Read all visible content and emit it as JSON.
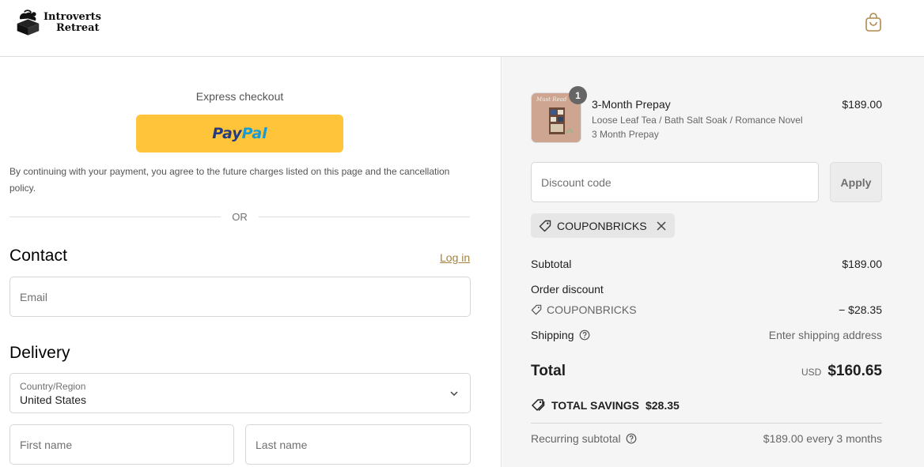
{
  "header": {
    "brand_line1": "Introverts",
    "brand_line2": "Retreat",
    "cart_icon": "shopping-bag-icon"
  },
  "checkout": {
    "express_label": "Express checkout",
    "paypal_part1": "Pay",
    "paypal_part2": "Pal",
    "consent_text": "By continuing with your payment, you agree to the future charges listed on this page and the cancellation policy.",
    "or_label": "OR",
    "contact": {
      "heading": "Contact",
      "login_link": "Log in",
      "email_placeholder": "Email"
    },
    "delivery": {
      "heading": "Delivery",
      "country_label": "Country/Region",
      "country_value": "United States",
      "first_name_placeholder": "First name",
      "last_name_placeholder": "Last name"
    }
  },
  "summary": {
    "item": {
      "quantity": "1",
      "name": "3-Month Prepay",
      "variant": "Loose Leaf Tea / Bath Salt Soak / Romance Novel",
      "plan": "3 Month Prepay",
      "price": "$189.00",
      "thumb_caption": "Must Read"
    },
    "discount_placeholder": "Discount code",
    "apply_label": "Apply",
    "applied_code": "COUPONBRICKS",
    "subtotal_label": "Subtotal",
    "subtotal_value": "$189.00",
    "order_discount_label": "Order discount",
    "discount_code": "COUPONBRICKS",
    "discount_value": "− $28.35",
    "shipping_label": "Shipping",
    "shipping_value": "Enter shipping address",
    "total_label": "Total",
    "currency": "USD",
    "total_value": "$160.65",
    "savings_label": "TOTAL SAVINGS",
    "savings_value": "$28.35",
    "recurring_label": "Recurring subtotal",
    "recurring_value": "$189.00 every 3 months"
  },
  "colors": {
    "paypal_yellow": "#ffc439",
    "link_gold": "#a6813f",
    "summary_bg": "#f5f5f5"
  }
}
